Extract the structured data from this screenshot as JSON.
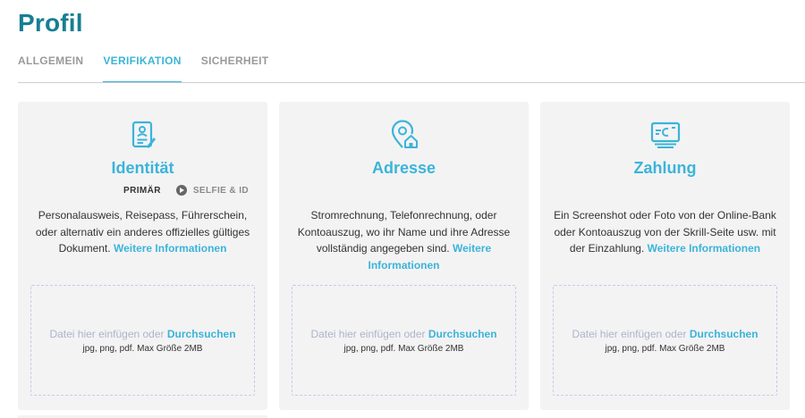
{
  "page": {
    "title": "Profil"
  },
  "tabs": [
    {
      "label": "ALLGEMEIN",
      "active": false
    },
    {
      "label": "VERIFIKATION",
      "active": true
    },
    {
      "label": "SICHERHEIT",
      "active": false
    }
  ],
  "colors": {
    "accent": "#3bb4d9",
    "title": "#157f93",
    "card_bg": "#f3f3f4",
    "dropzone_border": "#c6cbe8"
  },
  "cards": [
    {
      "icon": "id-card-icon",
      "title": "Identität",
      "sub_tabs": {
        "primary": "PRIMÄR",
        "secondary": "SELFIE & ID"
      },
      "description": "Personalausweis, Reisepass, Führerschein, oder alternativ ein anderes offizielles gültiges Dokument.",
      "link": "Weitere Informationen",
      "dropzone": {
        "text": "Datei hier einfügen oder",
        "browse": "Durchsuchen",
        "hint": "jpg, png, pdf. Max Größe 2MB"
      }
    },
    {
      "icon": "location-home-icon",
      "title": "Adresse",
      "description": "Stromrechnung, Telefonrechnung, oder Kontoauszug, wo ihr Name und ihre Adresse vollständig angegeben sind.",
      "link": "Weitere Informationen",
      "dropzone": {
        "text": "Datei hier einfügen oder",
        "browse": "Durchsuchen",
        "hint": "jpg, png, pdf. Max Größe 2MB"
      }
    },
    {
      "icon": "payment-screen-icon",
      "title": "Zahlung",
      "description": "Ein Screenshot oder Foto von der Online-Bank oder Kontoauszug von der Skrill-Seite usw. mit der Einzahlung.",
      "link": "Weitere Informationen",
      "dropzone": {
        "text": "Datei hier einfügen oder",
        "browse": "Durchsuchen",
        "hint": "jpg, png, pdf. Max Größe 2MB"
      }
    }
  ]
}
